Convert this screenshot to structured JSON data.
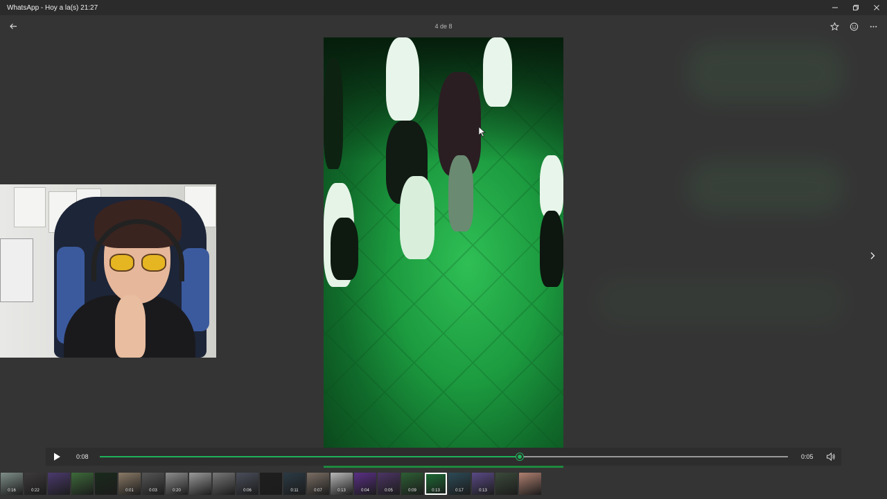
{
  "window": {
    "title": "WhatsApp - Hoy a la(s) 21:27",
    "controls": [
      "minimize-icon",
      "restore-icon",
      "close-icon"
    ]
  },
  "viewer": {
    "counter": "4 de 8",
    "actions": [
      "star-icon",
      "emoji-icon",
      "more-icon"
    ]
  },
  "player": {
    "current_time": "0:08",
    "total_time": "0:05",
    "progress": 0.61
  },
  "thumbnails": [
    {
      "duration": "0:16",
      "color": "#7f8f8a"
    },
    {
      "duration": "0:22",
      "color": "#3e3a3c"
    },
    {
      "duration": "",
      "color": "#4b3a6e"
    },
    {
      "duration": "",
      "color": "#3d6a3a"
    },
    {
      "duration": "",
      "color": "#1a2a1c"
    },
    {
      "duration": "0:01",
      "color": "#8a7a66"
    },
    {
      "duration": "0:03",
      "color": "#555555"
    },
    {
      "duration": "0:20",
      "color": "#8c8c8c"
    },
    {
      "duration": "",
      "color": "#9a9a9a"
    },
    {
      "duration": "",
      "color": "#777777"
    },
    {
      "duration": "0:06",
      "color": "#4a4e5a"
    },
    {
      "duration": "",
      "color": "#1e1e1e"
    },
    {
      "duration": "0:11",
      "color": "#2b3a44"
    },
    {
      "duration": "0:07",
      "color": "#7a6e64"
    },
    {
      "duration": "0:13",
      "color": "#b8b8b8"
    },
    {
      "duration": "0:04",
      "color": "#5a2f86"
    },
    {
      "duration": "0:05",
      "color": "#4c3564"
    },
    {
      "duration": "0:09",
      "color": "#2d5f34"
    },
    {
      "duration": "0:13",
      "color": "#1b6d35",
      "selected": true
    },
    {
      "duration": "0:17",
      "color": "#2c4a56"
    },
    {
      "duration": "0:13",
      "color": "#5a4a86"
    },
    {
      "duration": "",
      "color": "#3b4a3a"
    },
    {
      "duration": "",
      "color": "#b08070"
    }
  ]
}
